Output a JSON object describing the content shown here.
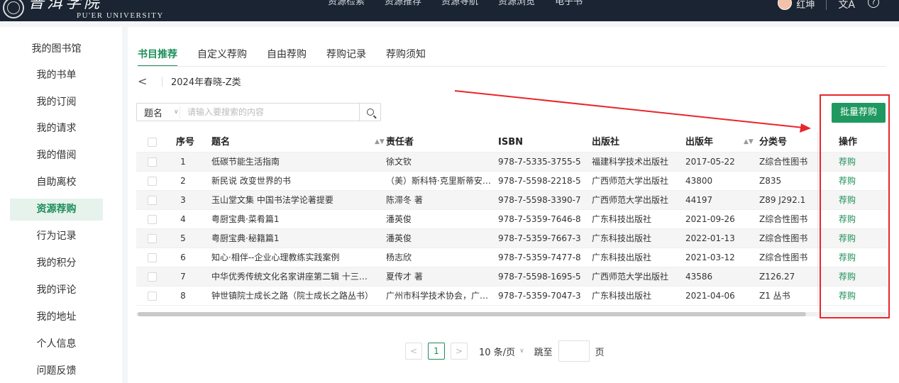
{
  "header": {
    "logo_cn": "普洱学院",
    "logo_en": "PU'ER UNIVERSITY",
    "nav": [
      "资源检索",
      "资源推荐",
      "资源导航",
      "资源浏览",
      "电子书"
    ],
    "username": "红坤",
    "translate_glyph": "文A",
    "help_glyph": "?"
  },
  "sidebar": {
    "items": [
      {
        "label": "我的图书馆",
        "active": false
      },
      {
        "label": "我的书单",
        "active": false
      },
      {
        "label": "我的订阅",
        "active": false
      },
      {
        "label": "我的请求",
        "active": false
      },
      {
        "label": "我的借阅",
        "active": false
      },
      {
        "label": "自助离校",
        "active": false
      },
      {
        "label": "资源荐购",
        "active": true
      },
      {
        "label": "行为记录",
        "active": false
      },
      {
        "label": "我的积分",
        "active": false
      },
      {
        "label": "我的评论",
        "active": false
      },
      {
        "label": "我的地址",
        "active": false
      },
      {
        "label": "个人信息",
        "active": false
      },
      {
        "label": "问题反馈",
        "active": false
      }
    ]
  },
  "main": {
    "tabs": [
      {
        "label": "书目推荐",
        "active": true
      },
      {
        "label": "自定义荐购",
        "active": false
      },
      {
        "label": "自由荐购",
        "active": false
      },
      {
        "label": "荐购记录",
        "active": false
      },
      {
        "label": "荐购须知",
        "active": false
      }
    ],
    "breadcrumb": {
      "back_glyph": "<",
      "title": "2024年春晓-Z类"
    },
    "search": {
      "field": "题名",
      "placeholder": "请输入要搜索的内容"
    },
    "batch_button": "批量荐购",
    "table": {
      "headers": {
        "index": "序号",
        "title": "题名",
        "author": "责任者",
        "isbn": "ISBN",
        "publisher": "出版社",
        "year": "出版年",
        "classno": "分类号",
        "op": "操作"
      },
      "rows": [
        {
          "index": "1",
          "title": "低碳节能生活指南",
          "author": "徐文钦",
          "isbn": "978-7-5335-3755-5",
          "publisher": "福建科学技术出版社",
          "year": "2017-05-22",
          "classno": "Z综合性图书",
          "op": "荐购"
        },
        {
          "index": "2",
          "title": "新民说 改变世界的书",
          "author": "（美）斯科特·克里斯蒂安…",
          "isbn": "978-7-5598-2218-5",
          "publisher": "广西师范大学出版社",
          "year": "43800",
          "classno": "Z835",
          "op": "荐购"
        },
        {
          "index": "3",
          "title": "玉山堂文集 中国书法学论著提要",
          "author": "陈滞冬 著",
          "isbn": "978-7-5598-3390-7",
          "publisher": "广西师范大学出版社",
          "year": "44197",
          "classno": "Z89 J292.1",
          "op": "荐购"
        },
        {
          "index": "4",
          "title": "粤厨宝典·菜肴篇1",
          "author": "潘英俊",
          "isbn": "978-7-5359-7646-8",
          "publisher": "广东科技出版社",
          "year": "2021-09-26",
          "classno": "Z综合性图书",
          "op": "荐购"
        },
        {
          "index": "5",
          "title": "粤厨宝典·秘籍篇1",
          "author": "潘英俊",
          "isbn": "978-7-5359-7667-3",
          "publisher": "广东科技出版社",
          "year": "2022-01-13",
          "classno": "Z综合性图书",
          "op": "荐购"
        },
        {
          "index": "6",
          "title": "知心·相伴--企业心理教练实践案例",
          "author": "杨志欣",
          "isbn": "978-7-5359-7477-8",
          "publisher": "广东科技出版社",
          "year": "2021-03-12",
          "classno": "Z综合性图书",
          "op": "荐购"
        },
        {
          "index": "7",
          "title": "中华优秀传统文化名家讲座第二辑 十三经…",
          "author": "夏传才 著",
          "isbn": "978-7-5598-1695-5",
          "publisher": "广西师范大学出版社",
          "year": "43586",
          "classno": "Z126.27",
          "op": "荐购"
        },
        {
          "index": "8",
          "title": "钟世镇院士成长之路（院士成长之路丛书）",
          "author": "广州市科学技术协会，广…",
          "isbn": "978-7-5359-7047-3",
          "publisher": "广东科技出版社",
          "year": "2021-04-06",
          "classno": "Z1 丛书",
          "op": "荐购"
        }
      ]
    },
    "pagination": {
      "prev_glyph": "<",
      "current": "1",
      "next_glyph": ">",
      "page_size": "10 条/页",
      "jump_label": "跳至",
      "page_unit": "页"
    }
  },
  "colors": {
    "accent": "#1d8e5a",
    "button": "#1f9960",
    "header_bg": "#1a2433",
    "annotation": "#e8262b"
  }
}
